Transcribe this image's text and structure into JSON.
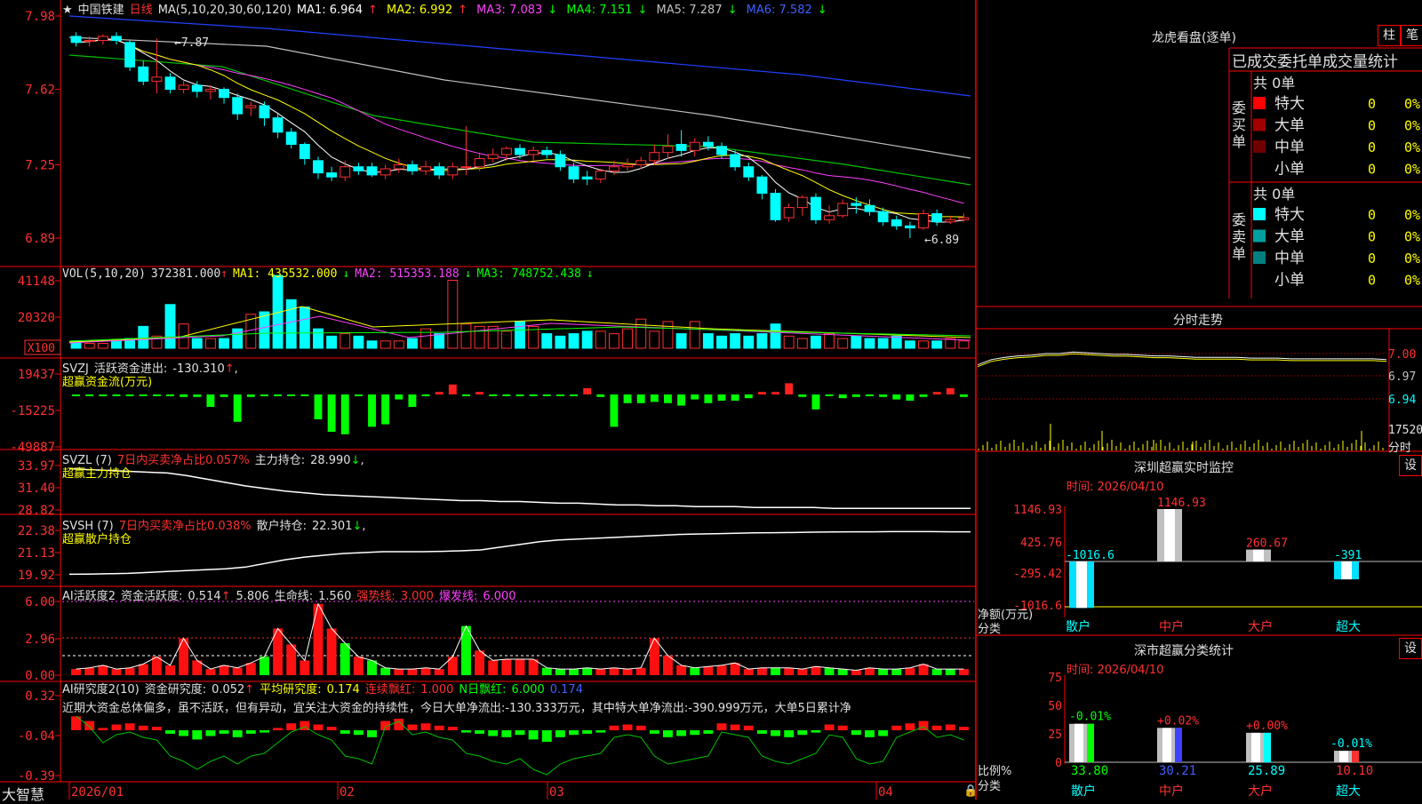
{
  "main": {
    "stock_name": "中国铁建",
    "period": "日线",
    "ma_title": "MA(5,10,20,30,60,120)",
    "ma": [
      {
        "label": "MA1:",
        "value": "6.964",
        "arrow": "↑",
        "color": "#ffffff"
      },
      {
        "label": "MA2:",
        "value": "6.992",
        "arrow": "↑",
        "color": "#ffff00"
      },
      {
        "label": "MA3:",
        "value": "7.083",
        "arrow": "↓",
        "color": "#ff40ff"
      },
      {
        "label": "MA4:",
        "value": "7.151",
        "arrow": "↓",
        "color": "#00ff00"
      },
      {
        "label": "MA5:",
        "value": "7.287",
        "arrow": "↓",
        "color": "#c0c0c0"
      },
      {
        "label": "MA6:",
        "value": "7.582",
        "arrow": "↓",
        "color": "#4060ff"
      }
    ],
    "y_ticks": [
      "7.98",
      "7.62",
      "7.25",
      "6.89"
    ],
    "high_marker": "7.87",
    "low_marker": "6.89",
    "candles_open": [
      7.88,
      7.86,
      7.86,
      7.88,
      7.85,
      7.73,
      7.66,
      7.68,
      7.62,
      7.64,
      7.61,
      7.62,
      7.58,
      7.53,
      7.54,
      7.48,
      7.41,
      7.35,
      7.27,
      7.21,
      7.19,
      7.24,
      7.24,
      7.2,
      7.23,
      7.25,
      7.22,
      7.24,
      7.2,
      7.24,
      7.24,
      7.28,
      7.3,
      7.33,
      7.3,
      7.32,
      7.3,
      7.24,
      7.19,
      7.18,
      7.22,
      7.24,
      7.25,
      7.27,
      7.31,
      7.35,
      7.32,
      7.36,
      7.34,
      7.3,
      7.24,
      7.19,
      7.11,
      6.99,
      7.04,
      7.09,
      6.98,
      7.0,
      7.06,
      7.05,
      7.02,
      6.98,
      6.95,
      6.94,
      7.01,
      6.97,
      6.98
    ],
    "candles_close": [
      7.85,
      7.86,
      7.88,
      7.86,
      7.73,
      7.66,
      7.68,
      7.62,
      7.64,
      7.61,
      7.62,
      7.58,
      7.5,
      7.54,
      7.48,
      7.41,
      7.35,
      7.28,
      7.21,
      7.19,
      7.24,
      7.22,
      7.2,
      7.23,
      7.25,
      7.22,
      7.24,
      7.2,
      7.24,
      7.24,
      7.28,
      7.3,
      7.33,
      7.3,
      7.32,
      7.3,
      7.24,
      7.18,
      7.18,
      7.22,
      7.24,
      7.25,
      7.27,
      7.31,
      7.34,
      7.32,
      7.36,
      7.34,
      7.3,
      7.24,
      7.19,
      7.11,
      6.98,
      7.04,
      7.09,
      6.98,
      7.0,
      7.06,
      7.05,
      7.02,
      6.97,
      6.95,
      6.94,
      7.01,
      6.97,
      6.98,
      6.99
    ],
    "candles_high": [
      7.9,
      7.88,
      7.89,
      7.9,
      7.86,
      7.76,
      7.87,
      7.7,
      7.66,
      7.66,
      7.64,
      7.63,
      7.6,
      7.56,
      7.56,
      7.5,
      7.43,
      7.36,
      7.29,
      7.24,
      7.27,
      7.26,
      7.26,
      7.25,
      7.28,
      7.27,
      7.27,
      7.26,
      7.26,
      7.44,
      7.31,
      7.33,
      7.34,
      7.35,
      7.34,
      7.34,
      7.32,
      7.26,
      7.22,
      7.23,
      7.27,
      7.28,
      7.29,
      7.35,
      7.4,
      7.42,
      7.38,
      7.39,
      7.36,
      7.32,
      7.26,
      7.2,
      7.13,
      7.06,
      7.1,
      7.11,
      7.05,
      7.08,
      7.09,
      7.08,
      7.04,
      7.0,
      6.97,
      7.03,
      7.03,
      7.0,
      7.01
    ],
    "candles_low": [
      7.83,
      7.83,
      7.84,
      7.84,
      7.71,
      7.64,
      7.6,
      7.6,
      7.6,
      7.58,
      7.57,
      7.55,
      7.47,
      7.49,
      7.44,
      7.38,
      7.33,
      7.25,
      7.18,
      7.17,
      7.17,
      7.2,
      7.19,
      7.18,
      7.21,
      7.2,
      7.2,
      7.18,
      7.18,
      7.2,
      7.22,
      7.26,
      7.27,
      7.28,
      7.27,
      7.28,
      7.22,
      7.16,
      7.15,
      7.16,
      7.2,
      7.22,
      7.23,
      7.25,
      7.28,
      7.29,
      7.29,
      7.32,
      7.28,
      7.22,
      7.17,
      7.08,
      6.97,
      6.97,
      7.0,
      6.96,
      6.96,
      6.99,
      7.01,
      7.0,
      6.95,
      6.93,
      6.89,
      6.93,
      6.95,
      6.96,
      6.97
    ]
  },
  "vol": {
    "title": "VOL(5,10,20)",
    "value": "372381.000",
    "value_arrow": "↑",
    "ma": [
      {
        "label": "MA1:",
        "value": "435532.000",
        "arrow": "↓",
        "color": "#ffff00"
      },
      {
        "label": "MA2:",
        "value": "515353.188",
        "arrow": "↓",
        "color": "#ff40ff"
      },
      {
        "label": "MA3:",
        "value": "748752.438",
        "arrow": "↓",
        "color": "#00ff00"
      }
    ],
    "y_ticks": [
      "41148",
      "20320"
    ],
    "unit": "X100",
    "bars": [
      3,
      2,
      2,
      3,
      4,
      9,
      5,
      18,
      10,
      4,
      4,
      4,
      8,
      14,
      15,
      30,
      20,
      17,
      8,
      5,
      6,
      5,
      3,
      3,
      3,
      4,
      8,
      6,
      28,
      10,
      9,
      9,
      7,
      11,
      9,
      6,
      5,
      6,
      7,
      7,
      6,
      8,
      12,
      7,
      11,
      6,
      11,
      6,
      5,
      6,
      5,
      6,
      10,
      5,
      4,
      5,
      6,
      4,
      5,
      4,
      4,
      5,
      3,
      3,
      3,
      4,
      3
    ]
  },
  "svzj": {
    "title": "SVZJ",
    "label": "活跃资金进出:",
    "value": "-130.310",
    "arrow": "↑",
    "suffix": ",",
    "subtitle": "超赢资金流(万元)",
    "y_ticks": [
      "19437",
      "-15225",
      "-49887"
    ],
    "bars": [
      -1,
      -1,
      -1,
      -1,
      -1,
      -1,
      -1,
      -1,
      -2,
      -2,
      -10,
      -2,
      -22,
      -2,
      -1,
      -1,
      -1,
      -1,
      -20,
      -30,
      -32,
      -1,
      -26,
      -24,
      -4,
      -10,
      -1,
      2,
      8,
      -1,
      2,
      -1,
      -1,
      -1,
      -1,
      -1,
      -1,
      -1,
      5,
      -2,
      -26,
      -7,
      -7,
      -6,
      -7,
      -9,
      -4,
      -7,
      -5,
      -5,
      -3,
      2,
      2,
      9,
      -2,
      -12,
      -1,
      -3,
      -2,
      -1,
      -2,
      -4,
      -5,
      -2,
      2,
      5,
      -2,
      -2
    ]
  },
  "svzl": {
    "title": "SVZL (7)",
    "label1": "7日内买卖净占比",
    "value1": "0.057%",
    "label2": "主力持仓:",
    "value2": "28.990",
    "arrow": "↓",
    "suffix": ",",
    "subtitle": "超赢主力持仓",
    "y_ticks": [
      "33.97",
      "31.40",
      "28.82"
    ],
    "line": [
      33.6,
      33.5,
      33.4,
      33.3,
      33.2,
      33.1,
      32.8,
      32.4,
      32.0,
      31.6,
      31.3,
      31.0,
      30.8,
      30.6,
      30.5,
      30.4,
      30.3,
      30.2,
      30.1,
      30.0,
      29.9,
      29.9,
      29.8,
      29.8,
      29.7,
      29.6,
      29.6,
      29.5,
      29.4,
      29.4,
      29.3,
      29.3,
      29.2,
      29.2,
      29.2,
      29.1,
      29.1,
      29.1,
      29.1,
      29.0,
      29.0,
      29.0,
      29.0,
      29.0,
      29.0,
      29.0,
      28.99
    ]
  },
  "svsh": {
    "title": "SVSH (7)",
    "label1": "7日内买卖净占比",
    "value1": "0.038%",
    "label2": "散户持仓:",
    "value2": "22.301",
    "arrow": "↓",
    "suffix": ",",
    "subtitle": "超赢散户持仓",
    "y_ticks": [
      "22.38",
      "21.13",
      "19.92"
    ],
    "line": [
      19.95,
      19.96,
      19.98,
      20.0,
      20.05,
      20.1,
      20.15,
      20.2,
      20.25,
      20.35,
      20.55,
      20.75,
      20.9,
      21.0,
      21.1,
      21.15,
      21.2,
      21.2,
      21.2,
      21.22,
      21.25,
      21.3,
      21.45,
      21.6,
      21.75,
      21.85,
      21.9,
      21.95,
      22.0,
      22.05,
      22.1,
      22.15,
      22.18,
      22.2,
      22.22,
      22.24,
      22.25,
      22.26,
      22.28,
      22.29,
      22.3,
      22.3,
      22.31,
      22.31,
      22.31,
      22.3,
      22.3
    ]
  },
  "ai_active": {
    "title": "AI活跃度2",
    "label": "资金活跃度:",
    "value": "0.514",
    "arrow": "↑",
    "value2": "5.806",
    "label3": "生命线:",
    "value3": "1.560",
    "label4": "强势线:",
    "value4": "3.000",
    "label5": "爆发线:",
    "value5": "6.000",
    "y_ticks": [
      "6.00",
      "2.96",
      "0.00"
    ],
    "bars": [
      0.5,
      0.6,
      0.8,
      0.5,
      0.6,
      0.9,
      1.5,
      0.8,
      3.0,
      1.2,
      0.5,
      0.8,
      0.6,
      1.0,
      1.5,
      3.8,
      2.5,
      1.2,
      5.8,
      3.8,
      2.6,
      1.5,
      1.2,
      0.6,
      0.5,
      0.5,
      0.6,
      0.5,
      1.5,
      4.0,
      2.0,
      1.2,
      1.3,
      1.3,
      1.3,
      0.6,
      0.5,
      0.5,
      0.6,
      0.5,
      0.6,
      0.5,
      0.6,
      3.0,
      1.6,
      0.8,
      0.6,
      0.7,
      0.8,
      1.0,
      0.5,
      0.6,
      0.6,
      0.6,
      0.5,
      0.7,
      0.6,
      0.5,
      0.4,
      0.6,
      0.5,
      0.5,
      0.6,
      0.9,
      0.5,
      0.5,
      0.5
    ],
    "green_idx": [
      14,
      20,
      22,
      23,
      29,
      35,
      36,
      37,
      38,
      46,
      52,
      56,
      57,
      60,
      61,
      64,
      65
    ]
  },
  "ai_research": {
    "title": "AI研究度2(10)",
    "label": "资金研究度:",
    "value": "0.052",
    "arrow": "↑",
    "label2": "平均研究度:",
    "value2": "0.174",
    "label3": "连续飘红:",
    "value3": "1.000",
    "label4": "N日飘红:",
    "value4": "6.000",
    "value5": "0.174",
    "comment": "近期大资金总体偏多，虽不活跃，但有异动，宜关注大资金的持续性，今日大单净流出:-130.333万元，其中特大单净流出:-390.999万元，大单5日累计净",
    "y_ticks": [
      "0.32",
      "-0.04",
      "-0.39"
    ],
    "bars": [
      0.12,
      0.08,
      0.02,
      0.05,
      0.06,
      0.04,
      0.03,
      -0.03,
      -0.05,
      -0.08,
      -0.05,
      -0.03,
      -0.06,
      -0.03,
      -0.02,
      0.02,
      0.06,
      0.08,
      0.05,
      0.03,
      -0.03,
      -0.04,
      -0.06,
      0.08,
      0.1,
      0.05,
      0.06,
      0.04,
      0.03,
      -0.02,
      -0.03,
      -0.05,
      -0.06,
      -0.04,
      -0.08,
      -0.1,
      -0.06,
      -0.04,
      -0.03,
      -0.02,
      0.04,
      0.05,
      0.04,
      -0.03,
      -0.06,
      -0.05,
      -0.04,
      -0.03,
      0.06,
      0.05,
      0.04,
      -0.03,
      -0.05,
      -0.06,
      -0.04,
      -0.02,
      0.05,
      0.04,
      -0.04,
      -0.06,
      -0.05,
      0.04,
      0.06,
      0.08,
      0.04,
      0.05,
      0.03
    ]
  },
  "x_axis": {
    "labels": [
      "2026/01",
      "02",
      "03",
      "04"
    ],
    "brand": "大智慧"
  },
  "dragon": {
    "title": "龙虎看盘(逐单)",
    "btn_bar": "柱",
    "btn_pen": "笔",
    "header": "已成交委托单成交量统计",
    "buy_total": "共 0单",
    "buy_label": "委买单",
    "sell_total": "共 0单",
    "sell_label": "委卖单",
    "buy_rows": [
      {
        "name": "特大",
        "count": "0",
        "pct": "0%",
        "color": "#ff0000"
      },
      {
        "name": "大单",
        "count": "0",
        "pct": "0%",
        "color": "#a00000"
      },
      {
        "name": "中单",
        "count": "0",
        "pct": "0%",
        "color": "#700000"
      },
      {
        "name": "小单",
        "count": "0",
        "pct": "0%",
        "color": ""
      }
    ],
    "sell_rows": [
      {
        "name": "特大",
        "count": "0",
        "pct": "0%",
        "color": "#00ffff"
      },
      {
        "name": "大单",
        "count": "0",
        "pct": "0%",
        "color": "#00a0a0"
      },
      {
        "name": "中单",
        "count": "0",
        "pct": "0%",
        "color": "#008080"
      },
      {
        "name": "小单",
        "count": "0",
        "pct": "0%",
        "color": ""
      }
    ]
  },
  "intraday": {
    "title": "分时走势",
    "y_ticks": [
      "7.00",
      "6.97",
      "6.94"
    ],
    "vol_label": "17520",
    "unit_label": "分时",
    "line": [
      6.985,
      6.992,
      6.995,
      6.997,
      6.998,
      7.0,
      7.0,
      7.002,
      7.001,
      7.0,
      6.999,
      6.999,
      6.998,
      6.997,
      6.997,
      6.996,
      6.995,
      6.995,
      6.995,
      6.995,
      6.994,
      6.994,
      6.994,
      6.993,
      6.993,
      6.993,
      6.993,
      6.993,
      6.993,
      6.993,
      6.992
    ]
  },
  "sz_monitor": {
    "title": "深圳超赢实时监控",
    "btn": "设",
    "time": "时间: 2026/04/10",
    "y_ticks": [
      "1146.93",
      "425.76",
      "-295.42",
      "-1016.6"
    ],
    "y_label": "净额(万元)",
    "x_label": "分类",
    "categories": [
      "散户",
      "中户",
      "大户",
      "超大"
    ],
    "values": [
      -1016.6,
      1146.93,
      260.67,
      -391
    ],
    "value_labels": [
      "-1016.6",
      "1146.93",
      "260.67",
      "-391"
    ]
  },
  "sz_class": {
    "title": "深市超赢分类统计",
    "btn": "设",
    "time": "时间: 2026/04/10",
    "y_ticks": [
      "75",
      "50",
      "25",
      "0"
    ],
    "y_label": "比例%",
    "x_label": "分类",
    "categories": [
      "散户",
      "中户",
      "大户",
      "超大"
    ],
    "values": [
      33.8,
      30.21,
      25.89,
      10.1
    ],
    "changes": [
      "-0.01%",
      "+0.02%",
      "+0.00%",
      "-0.01%"
    ],
    "value_labels": [
      "33.80",
      "30.21",
      "25.89",
      "10.10"
    ]
  }
}
